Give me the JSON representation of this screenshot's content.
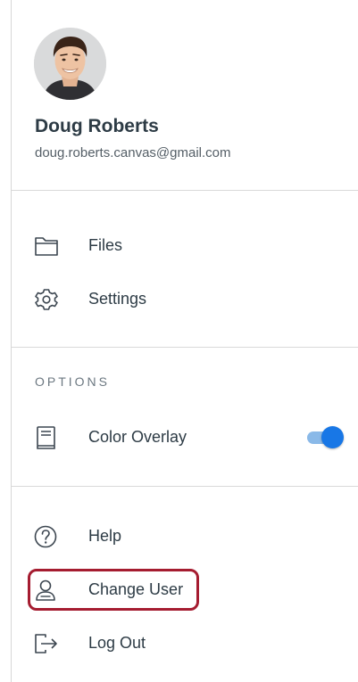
{
  "user": {
    "name": "Doug Roberts",
    "email": "doug.roberts.canvas@gmail.com"
  },
  "menu": {
    "files_label": "Files",
    "settings_label": "Settings"
  },
  "options": {
    "header": "OPTIONS",
    "color_overlay_label": "Color Overlay",
    "color_overlay_enabled": true
  },
  "account": {
    "help_label": "Help",
    "change_user_label": "Change User",
    "logout_label": "Log Out"
  },
  "icons": {
    "files": "folder-icon",
    "settings": "gear-icon",
    "color_overlay": "book-icon",
    "help": "help-circle-icon",
    "change_user": "user-icon",
    "logout": "logout-icon"
  },
  "colors": {
    "text_primary": "#2d3b45",
    "toggle_on": "#1877e6",
    "highlight": "#a51c30"
  }
}
